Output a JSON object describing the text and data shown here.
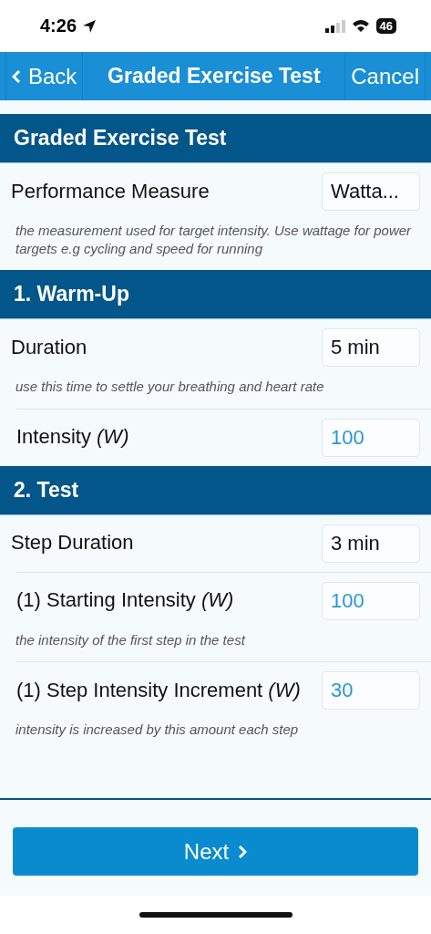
{
  "status_bar": {
    "time": "4:26",
    "battery": "46"
  },
  "nav": {
    "back": "Back",
    "title": "Graded Exercise Test",
    "cancel": "Cancel"
  },
  "sections": [
    {
      "title": "Graded Exercise Test",
      "rows": [
        {
          "kind": "picker",
          "label": "Performance Measure",
          "value": "Watta...",
          "hint": "the measurement used for target intensity. Use wattage for power targets e.g cycling and speed for running"
        }
      ]
    },
    {
      "title": "1. Warm-Up",
      "rows": [
        {
          "kind": "picker",
          "label": "Duration",
          "value": "5 min",
          "hint": "use this time to settle your breathing and heart rate"
        },
        {
          "kind": "number",
          "label": "Intensity *(W)*",
          "value": "100"
        }
      ]
    },
    {
      "title": "2. Test",
      "rows": [
        {
          "kind": "picker",
          "label": "Step Duration",
          "value": "3 min"
        },
        {
          "kind": "number",
          "label": "(1) Starting Intensity *(W)*",
          "value": "100",
          "hint": "the intensity of the first step in the test"
        },
        {
          "kind": "number",
          "label": "(1) Step Intensity Increment *(W)*",
          "value": "30",
          "hint": "intensity is increased by this amount each step"
        }
      ]
    }
  ],
  "next_button": "Next"
}
